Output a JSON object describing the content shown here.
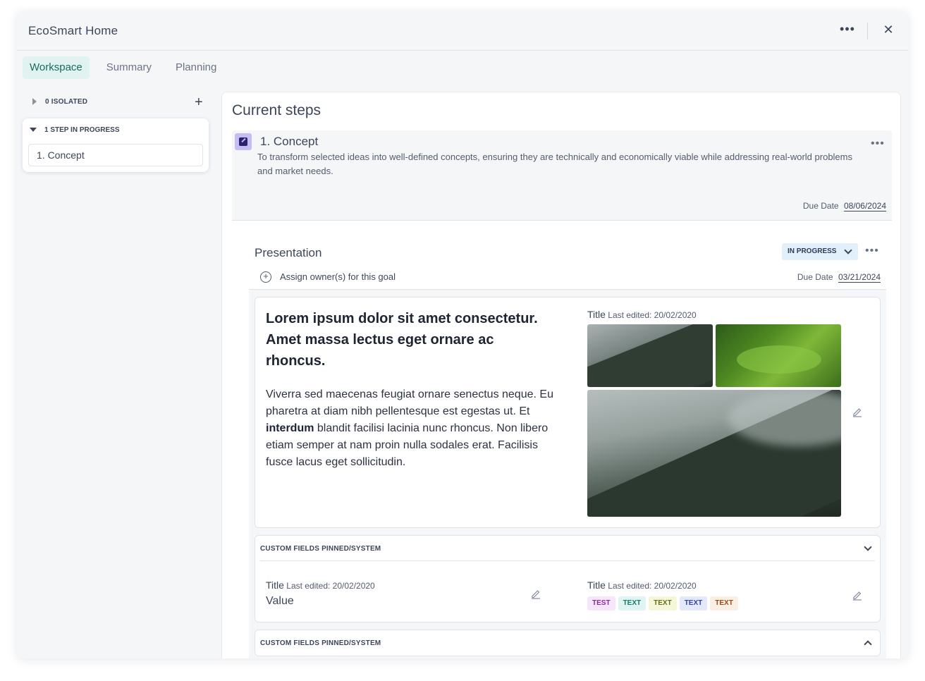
{
  "window": {
    "title": "EcoSmart Home",
    "more_icon": "more-horizontal-icon",
    "close_icon": "close-icon",
    "more_glyph": "•••",
    "close_glyph": "✕"
  },
  "tabs": [
    {
      "label": "Workspace",
      "active": true
    },
    {
      "label": "Summary",
      "active": false
    },
    {
      "label": "Planning",
      "active": false
    }
  ],
  "sidebar": {
    "isolated_label": "0 ISOLATED",
    "add_glyph": "+",
    "in_progress_label": "1 STEP IN PROGRESS",
    "items": [
      {
        "label": "1. Concept"
      }
    ]
  },
  "main": {
    "title": "Current steps",
    "step": {
      "title": "1. Concept",
      "description": "To transform selected ideas into well-defined concepts, ensuring they are technically and economically viable while addressing real-world problems and market needs.",
      "due_label": "Due Date",
      "due_date": "08/06/2024",
      "icon": "edit-square-icon",
      "icon_color": "#c5bdf3",
      "more_glyph": "•••"
    },
    "goal": {
      "title": "Presentation",
      "status": "IN PROGRESS",
      "status_color": "#e1f0fb",
      "more_glyph": "•••",
      "assign_glyph": "+",
      "assign_label": "Assign owner(s) for this goal",
      "due_label": "Due Date",
      "due_date": "03/21/2024",
      "content": {
        "headline": "Lorem ipsum dolor sit amet consectetur. Amet massa lectus eget ornare ac rhoncus.",
        "body_before": "Viverra sed maecenas feugiat ornare senectus neque. Eu pharetra at diam nibh pellentesque est egestas ut. Et ",
        "body_bold": "interdum",
        "body_after": " blandit facilisi lacinia nunc rhoncus. Non libero etiam semper at nam proin nulla sodales erat. Facilisis fusce lacus eget sollicitudin.",
        "media_title": "Title",
        "media_edited": "Last edited: 20/02/2020",
        "images": [
          "mountain-fog-image",
          "green-forest-image",
          "mountain-fog-large-image"
        ]
      },
      "custom_fields": [
        {
          "header": "CUSTOM FIELDS PINNED/SYSTEM",
          "expanded": true,
          "fields": [
            {
              "title": "Title",
              "edited": "Last edited: 20/02/2020",
              "value": "Value"
            },
            {
              "title": "Title",
              "edited": "Last edited: 20/02/2020",
              "tags": [
                {
                  "label": "TEST",
                  "bg": "#f7e6fb",
                  "fg": "#8a2a9e"
                },
                {
                  "label": "TEXT",
                  "bg": "#dff5f1",
                  "fg": "#177a6a"
                },
                {
                  "label": "TEXT",
                  "bg": "#f4f7d9",
                  "fg": "#6a6e12"
                },
                {
                  "label": "TEXT",
                  "bg": "#e4e8fb",
                  "fg": "#3342a8"
                },
                {
                  "label": "TEXT",
                  "bg": "#fbeee3",
                  "fg": "#9a4b17"
                }
              ]
            }
          ]
        },
        {
          "header": "CUSTOM FIELDS PINNED/SYSTEM",
          "expanded": false
        }
      ]
    }
  }
}
